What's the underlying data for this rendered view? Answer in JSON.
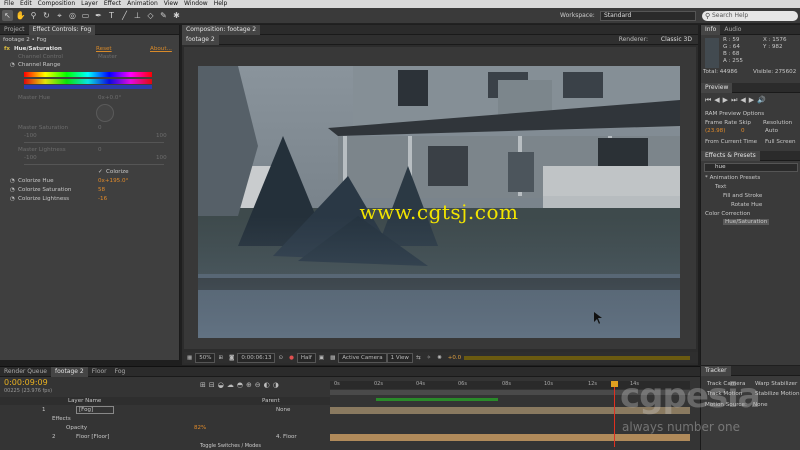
{
  "menu": [
    "File",
    "Edit",
    "Composition",
    "Layer",
    "Effect",
    "Animation",
    "View",
    "Window",
    "Help"
  ],
  "toolbar": {
    "tools": [
      "selection-tool",
      "hand-tool",
      "zoom-tool",
      "rotate-tool",
      "camera-tool",
      "pan-behind-tool",
      "rectangle-tool",
      "pen-tool",
      "type-tool",
      "brush-tool",
      "clone-stamp-tool",
      "eraser-tool",
      "roto-brush-tool",
      "puppet-pin-tool"
    ],
    "workspace_label": "Workspace:",
    "workspace_value": "Standard",
    "search_placeholder": "Search Help"
  },
  "left_panel": {
    "tabs": [
      "Project",
      "Effect Controls: Fog"
    ],
    "breadcrumb": "footage 2 • Fog",
    "effect_name": "Hue/Saturation",
    "reset_label": "Reset",
    "about_label": "About...",
    "channel_control_label": "Channel Control",
    "channel_control_value": "Master",
    "channel_range_label": "Channel Range",
    "master_hue_label": "Master Hue",
    "master_hue_value": "0x+0.0°",
    "master_saturation_label": "Master Saturation",
    "master_saturation_value": "0",
    "master_saturation_range": [
      "-100",
      "100"
    ],
    "master_lightness_label": "Master Lightness",
    "master_lightness_value": "0",
    "master_lightness_range": [
      "-100",
      "100"
    ],
    "colorize_label": "Colorize",
    "colorize_hue_label": "Colorize Hue",
    "colorize_hue_value": "0x+195.0°",
    "colorize_saturation_label": "Colorize Saturation",
    "colorize_saturation_value": "58",
    "colorize_lightness_label": "Colorize Lightness",
    "colorize_lightness_value": "-16"
  },
  "comp_panel": {
    "tab": "Composition: footage 2",
    "sub_tab": "footage 2",
    "renderer_label": "Renderer:",
    "renderer_value": "Classic 3D",
    "watermark": "www.cgtsj.com",
    "controls": {
      "zoom": "50%",
      "timecode": "0:00:06:13",
      "resolution": "Half",
      "view": "Active Camera",
      "views_count": "1 View",
      "exposure": "+0.0"
    }
  },
  "info_panel": {
    "tabs": [
      "Info",
      "Audio"
    ],
    "r": "R : 59",
    "g": "G : 64",
    "b": "B : 68",
    "a": "A : 255",
    "x": "X : 1576",
    "y": "Y : 982",
    "total": "Total: 44986",
    "visible": "Visible: 275602"
  },
  "preview_panel": {
    "tab": "Preview",
    "ram_options": "RAM Preview Options",
    "frame_rate_label": "Frame Rate",
    "skip_label": "Skip",
    "resolution_label": "Resolution",
    "frame_rate_value": "(23.98)",
    "skip_value": "0",
    "resolution_value": "Auto",
    "from_current": "From Current Time",
    "full_screen": "Full Screen"
  },
  "effects_panel": {
    "tab": "Effects & Presets",
    "search_value": "hue",
    "items": [
      "* Animation Presets",
      "Text",
      "Fill and Stroke",
      "Rotate Hue",
      "Color Correction",
      "Hue/Saturation"
    ]
  },
  "timeline": {
    "tabs": [
      "Render Queue",
      "footage 2",
      "Floor",
      "Fog"
    ],
    "timecode": "0:00:09:09",
    "fps": "00225 (23.976 fps)",
    "col_layer_name": "Layer Name",
    "col_parent": "Parent",
    "rows": [
      {
        "num": "1",
        "name": "[Fog]",
        "parent": "None"
      },
      {
        "num": "",
        "name": "Effects",
        "parent": ""
      },
      {
        "num": "",
        "name": "Opacity",
        "parent": "82%"
      },
      {
        "num": "2",
        "name": "Floor [Floor]",
        "parent": "4. Floor"
      }
    ],
    "ruler": [
      "0s",
      "02s",
      "04s",
      "06s",
      "08s",
      "10s",
      "12s",
      "14s"
    ],
    "toggle_label": "Toggle Switches / Modes"
  },
  "tracker_panel": {
    "tab": "Tracker",
    "track_camera": "Track Camera",
    "warp_stabilizer": "Warp Stabilizer",
    "track_motion": "Track Motion",
    "stabilize_motion": "Stabilize Motion",
    "motion_source": "Motion Source:",
    "motion_source_value": "None"
  },
  "watermark_logo": {
    "main": "cgpesia",
    "tagline": "always number one"
  }
}
